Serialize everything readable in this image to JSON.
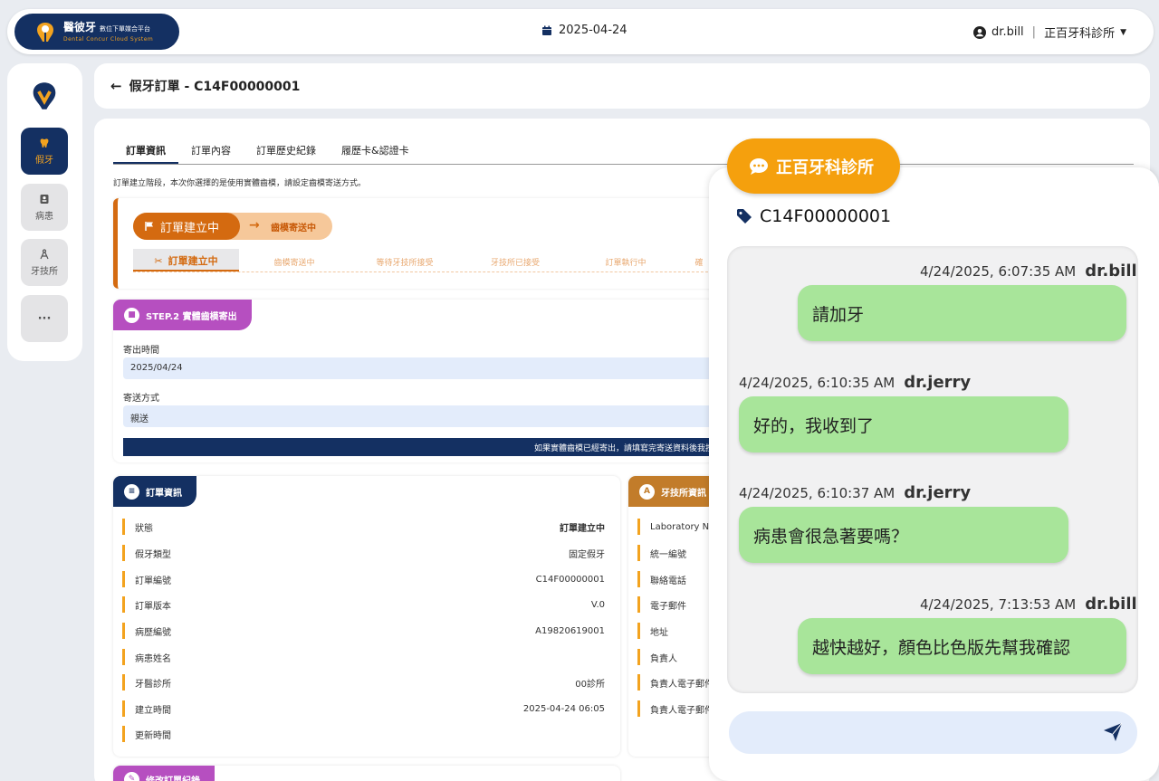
{
  "topbar": {
    "logo_title": "醫彼牙",
    "logo_sub": "數位下單媒合平台",
    "logo_en": "Dental Concur Cloud System",
    "date": "2025-04-24",
    "username": "dr.bill",
    "separator": "|",
    "clinic": "正百牙科診所"
  },
  "sidebar": {
    "items": [
      {
        "label": "假牙",
        "icon": "tooth-icon",
        "active": true
      },
      {
        "label": "病患",
        "icon": "patient-card-icon"
      },
      {
        "label": "牙技所",
        "icon": "compass-icon"
      },
      {
        "label": "···",
        "icon": "more-icon"
      }
    ]
  },
  "header": {
    "title": "假牙訂單 - C14F00000001"
  },
  "tabs": [
    "訂單資訊",
    "訂單內容",
    "訂單歷史紀錄",
    "履歷卡&認證卡"
  ],
  "notice": "訂單建立階段，本次你選擇的是使用實體齒模，請設定齒模寄送方式。",
  "progress": {
    "current": "訂單建立中",
    "next": "齒模寄送中",
    "steps": [
      "訂單建立中",
      "齒模寄送中",
      "等待牙技所接受",
      "牙技所已接受",
      "訂單執行中",
      "確"
    ]
  },
  "shipping": {
    "badge": "STEP.2 實體齒模寄出",
    "send_time_label": "寄出時間",
    "send_time": "2025/04/24",
    "method_label": "寄送方式",
    "method": "親送",
    "bar_text": "如果實體齒模已經寄出，請填寫完寄送資料後我按"
  },
  "order_info": {
    "badge": "訂單資訊",
    "rows": [
      {
        "k": "狀態",
        "v": "訂單建立中"
      },
      {
        "k": "假牙類型",
        "v": "固定假牙"
      },
      {
        "k": "訂單編號",
        "v": "C14F00000001"
      },
      {
        "k": "訂單版本",
        "v": "V.0"
      },
      {
        "k": "病歷編號",
        "v": "A19820619001"
      },
      {
        "k": "病患姓名",
        "v": ""
      },
      {
        "k": "牙醫診所",
        "v": "00診所"
      },
      {
        "k": "建立時間",
        "v": "2025-04-24 06:05"
      },
      {
        "k": "更新時間",
        "v": ""
      }
    ]
  },
  "lab_info": {
    "badge": "牙技所資訊",
    "rows": [
      "Laboratory Na",
      "統一編號",
      "聯絡電話",
      "電子郵件",
      "地址",
      "負責人",
      "負責人電子郵件",
      "負責人電子郵件"
    ]
  },
  "history_badge": "修改訂單紀錄",
  "chat": {
    "clinic": "正百牙科診所",
    "order_id": "C14F00000001",
    "messages": [
      {
        "time": "4/24/2025, 6:07:35 AM",
        "user": "dr.bill",
        "text": "請加牙"
      },
      {
        "time": "4/24/2025, 6:10:35 AM",
        "user": "dr.jerry",
        "text": "好的，我收到了"
      },
      {
        "time": "4/24/2025, 6:10:37 AM",
        "user": "dr.jerry",
        "text": "病患會很急著要嗎？"
      },
      {
        "time": "4/24/2025, 7:13:53 AM",
        "user": "dr.bill",
        "text": "越快越好，顏色比色版先幫我確認"
      }
    ],
    "input_placeholder": ""
  },
  "colors": {
    "navy": "#143062",
    "orange": "#d46a10",
    "amber": "#f5a00d",
    "purple": "#b64fc0",
    "bubble": "#a8e59a"
  }
}
